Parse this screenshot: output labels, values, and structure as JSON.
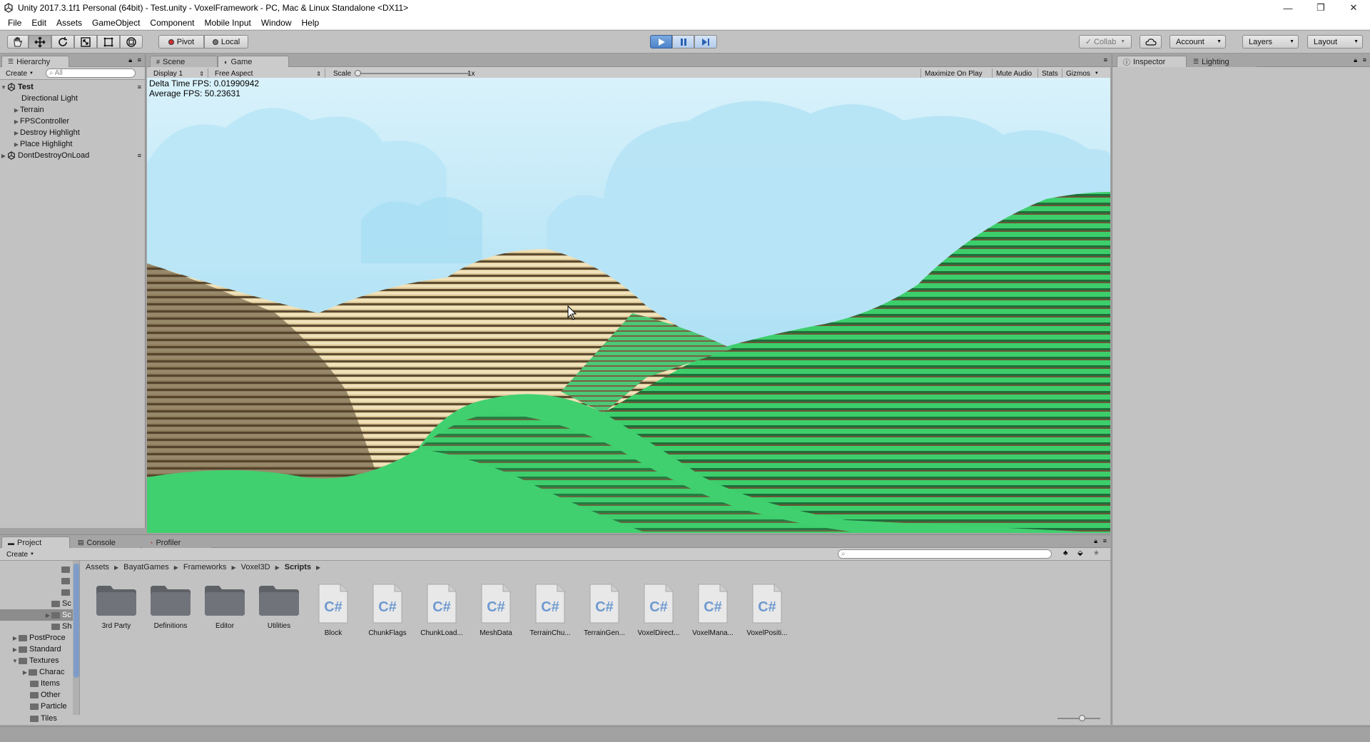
{
  "window": {
    "title": "Unity 2017.3.1f1 Personal (64bit) - Test.unity - VoxelFramework - PC, Mac & Linux Standalone <DX11>",
    "controls": [
      "—",
      "❐",
      "✕"
    ]
  },
  "menu": [
    "File",
    "Edit",
    "Assets",
    "GameObject",
    "Component",
    "Mobile Input",
    "Window",
    "Help"
  ],
  "toolbar": {
    "pivot": "Pivot",
    "local": "Local",
    "collab": "Collab",
    "account": "Account",
    "layers": "Layers",
    "layout": "Layout"
  },
  "hierarchy": {
    "tab": "Hierarchy",
    "create": "Create",
    "search_placeholder": "All",
    "scene": "Test",
    "items": [
      "Directional Light",
      "Terrain",
      "FPSController",
      "Destroy Highlight",
      "Place Highlight"
    ],
    "dont_destroy": "DontDestroyOnLoad"
  },
  "scene_tabs": {
    "scene": "Scene",
    "game": "Game"
  },
  "game_bar": {
    "display": "Display 1",
    "aspect": "Free Aspect",
    "scale_label": "Scale",
    "scale_value": "1x",
    "maximize": "Maximize On Play",
    "mute": "Mute Audio",
    "stats": "Stats",
    "gizmos": "Gizmos"
  },
  "game": {
    "delta_fps": "Delta Time FPS: 0.01990942",
    "avg_fps": "Average FPS: 50.23631"
  },
  "inspector": {
    "tab": "Inspector",
    "lighting": "Lighting"
  },
  "project": {
    "tabs": [
      "Project",
      "Console",
      "Profiler"
    ],
    "create": "Create",
    "breadcrumb": [
      "Assets",
      "BayatGames",
      "Frameworks",
      "Voxel3D",
      "Scripts"
    ],
    "folders": [
      "3rd Party",
      "Definitions",
      "Editor",
      "Utilities"
    ],
    "scripts": [
      "Block",
      "ChunkFlags",
      "ChunkLoad...",
      "MeshData",
      "TerrainChu...",
      "TerrainGen...",
      "VoxelDirect...",
      "VoxelMana...",
      "VoxelPositi..."
    ],
    "tree": [
      "Sc",
      "Sc",
      "Sh",
      "PostProce",
      "Standard",
      "Textures",
      "Charac",
      "Items",
      "Other",
      "Particle",
      "Tiles"
    ]
  },
  "colors": {
    "accent_play": "#4c82c9",
    "sky_top": "#d8f1fb",
    "sky_bottom": "#8fd3ee",
    "grass": "#3fce6e",
    "sand": "#ead9aa",
    "dirt": "#6b5638"
  }
}
